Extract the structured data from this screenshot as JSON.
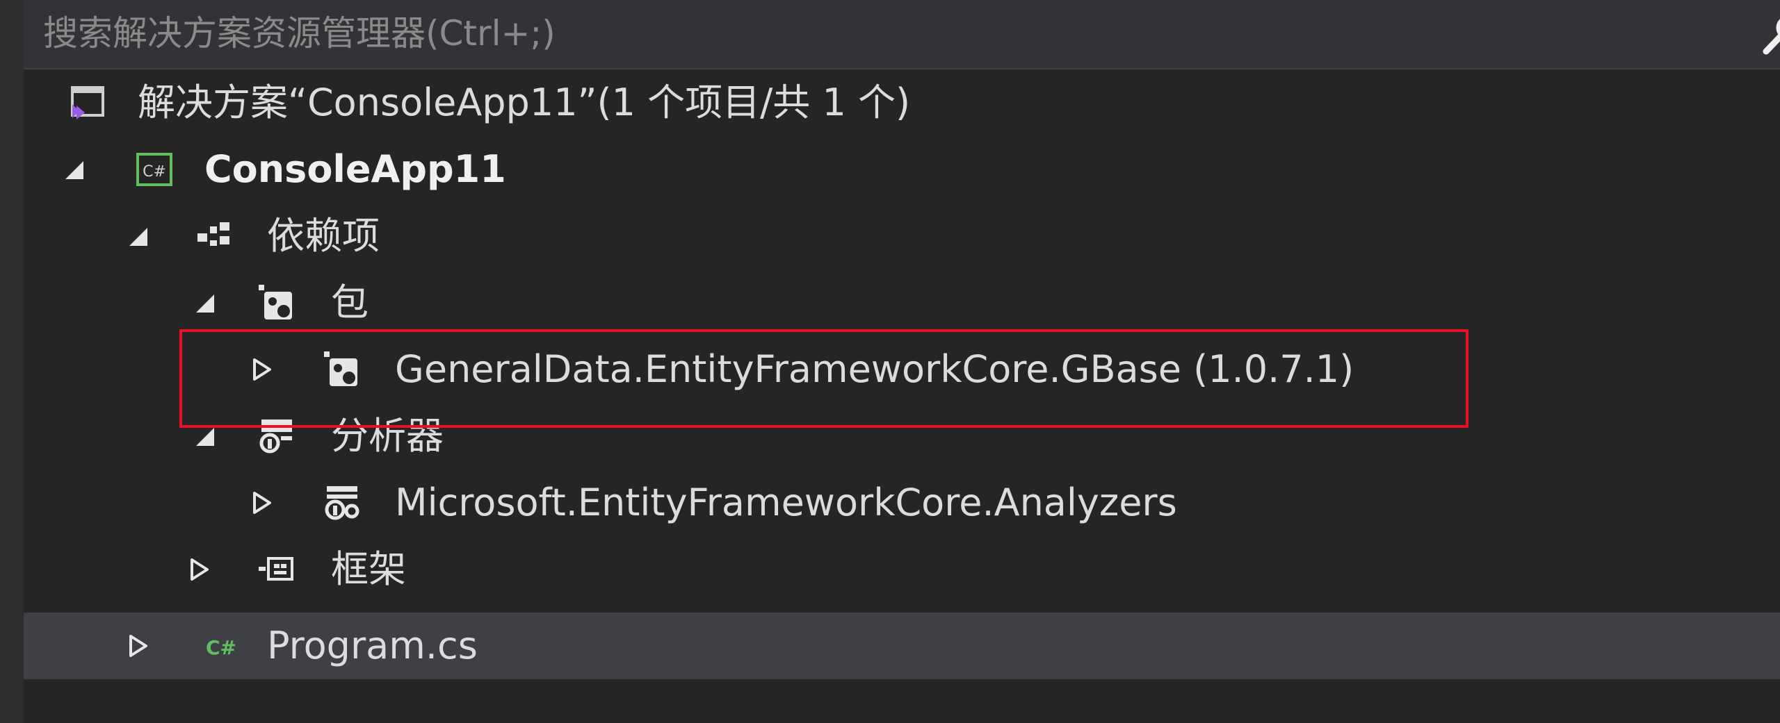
{
  "search": {
    "placeholder": "搜索解决方案资源管理器(Ctrl+;)"
  },
  "tree": {
    "solution_label": "解决方案“ConsoleApp11”(1 个项目/共 1 个)",
    "project_label": "ConsoleApp11",
    "dependencies_label": "依赖项",
    "packages_label": "包",
    "package_item_label": "GeneralData.EntityFrameworkCore.GBase (1.0.7.1)",
    "analyzers_label": "分析器",
    "analyzer_item_label": "Microsoft.EntityFrameworkCore.Analyzers",
    "frameworks_label": "框架",
    "program_file_label": "Program.cs"
  },
  "colors": {
    "background": "#252526",
    "search_bar": "#333337",
    "selected_row": "#3f3f46",
    "highlight_border": "#e81123",
    "csharp_green": "#5fbf5f",
    "vs_purple": "#9b5de5"
  },
  "icons": {
    "search": "search-icon",
    "solution": "solution-icon",
    "project": "csharp-project-icon",
    "dependencies": "dependencies-icon",
    "packages": "package-icon",
    "analyzers": "analyzer-icon",
    "frameworks": "framework-icon",
    "program_file": "csharp-file-icon"
  }
}
